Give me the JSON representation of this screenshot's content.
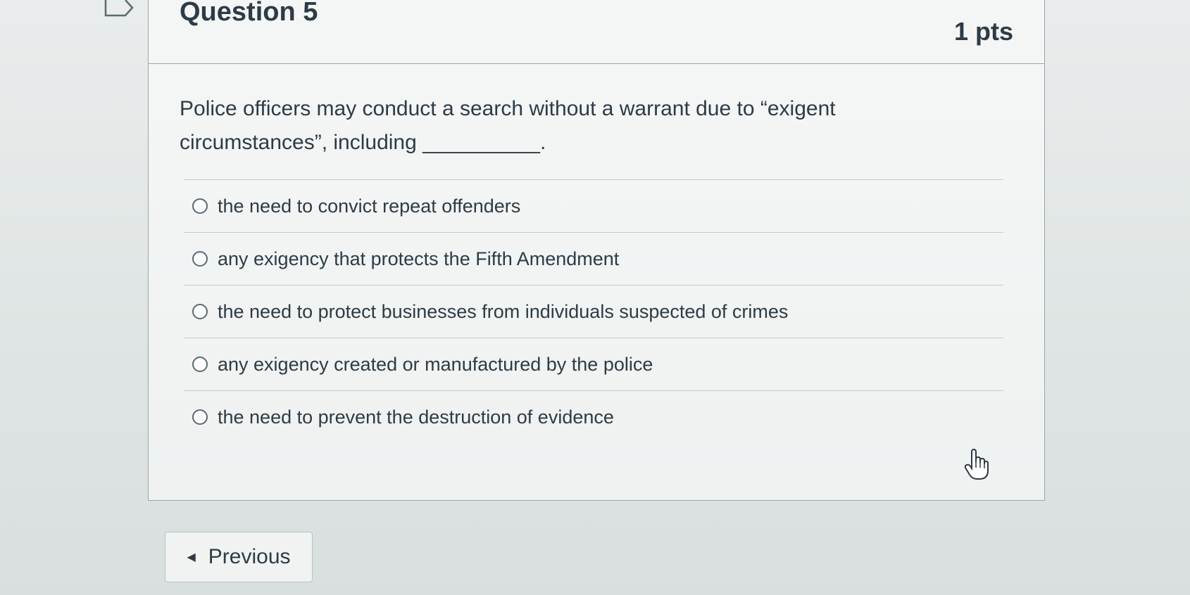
{
  "question": {
    "title": "Question 5",
    "points": "1 pts",
    "text": "Police officers may conduct a search without a warrant due to “exigent circumstances”, including __________.",
    "answers": [
      {
        "label": "the need to convict repeat offenders"
      },
      {
        "label": "any exigency that protects the Fifth Amendment"
      },
      {
        "label": "the need to protect businesses from individuals suspected of crimes"
      },
      {
        "label": "any exigency created or manufactured by the police"
      },
      {
        "label": "the need to prevent the destruction of evidence"
      }
    ]
  },
  "navigation": {
    "previous_label": "Previous"
  },
  "icons": {
    "flag": "flag-icon",
    "pointer": "hand-cursor-icon",
    "previous": "chevron-left-icon"
  }
}
